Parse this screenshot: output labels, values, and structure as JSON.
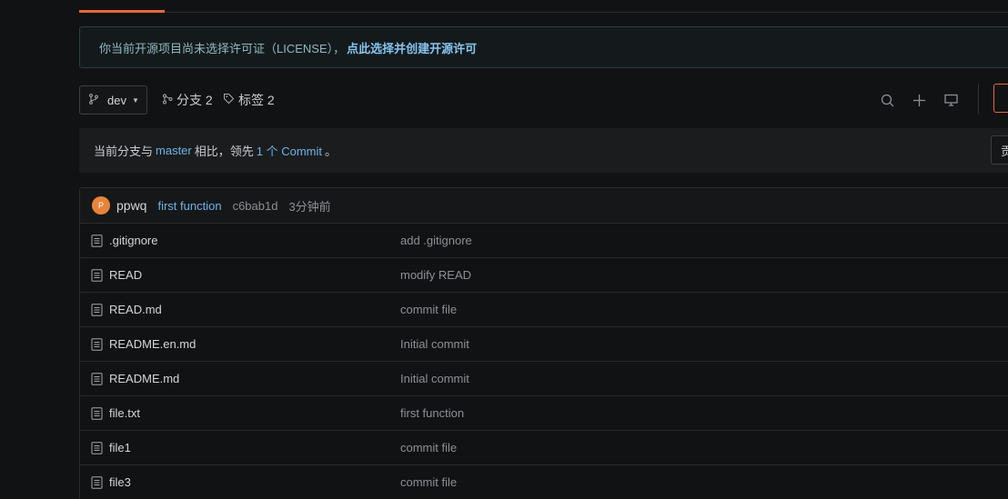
{
  "banner": {
    "text": "你当前开源项目尚未选择许可证（LICENSE），",
    "link": "点此选择并创建开源许可"
  },
  "toolbar": {
    "branch": "dev",
    "branches_label": "分支 2",
    "tags_label": "标签 2"
  },
  "compare": {
    "prefix": "当前分支与",
    "base_branch": "master",
    "middle": "相比，领先",
    "ahead": "1 个 Commit",
    "suffix": "。",
    "button_label": "贡"
  },
  "last_commit": {
    "avatar_letter": "P",
    "author": "ppwq",
    "message": "first function",
    "sha": "c6bab1d",
    "time": "3分钟前"
  },
  "files": [
    {
      "name": ".gitignore",
      "message": "add .gitignore"
    },
    {
      "name": "READ",
      "message": "modify READ"
    },
    {
      "name": "READ.md",
      "message": "commit file"
    },
    {
      "name": "README.en.md",
      "message": "Initial commit"
    },
    {
      "name": "README.md",
      "message": "Initial commit"
    },
    {
      "name": "file.txt",
      "message": "first function"
    },
    {
      "name": "file1",
      "message": "commit file"
    },
    {
      "name": "file3",
      "message": "commit file"
    }
  ],
  "colors": {
    "accent": "#e8683a",
    "link": "#6cb4e6",
    "avatar": "#e8843a"
  }
}
